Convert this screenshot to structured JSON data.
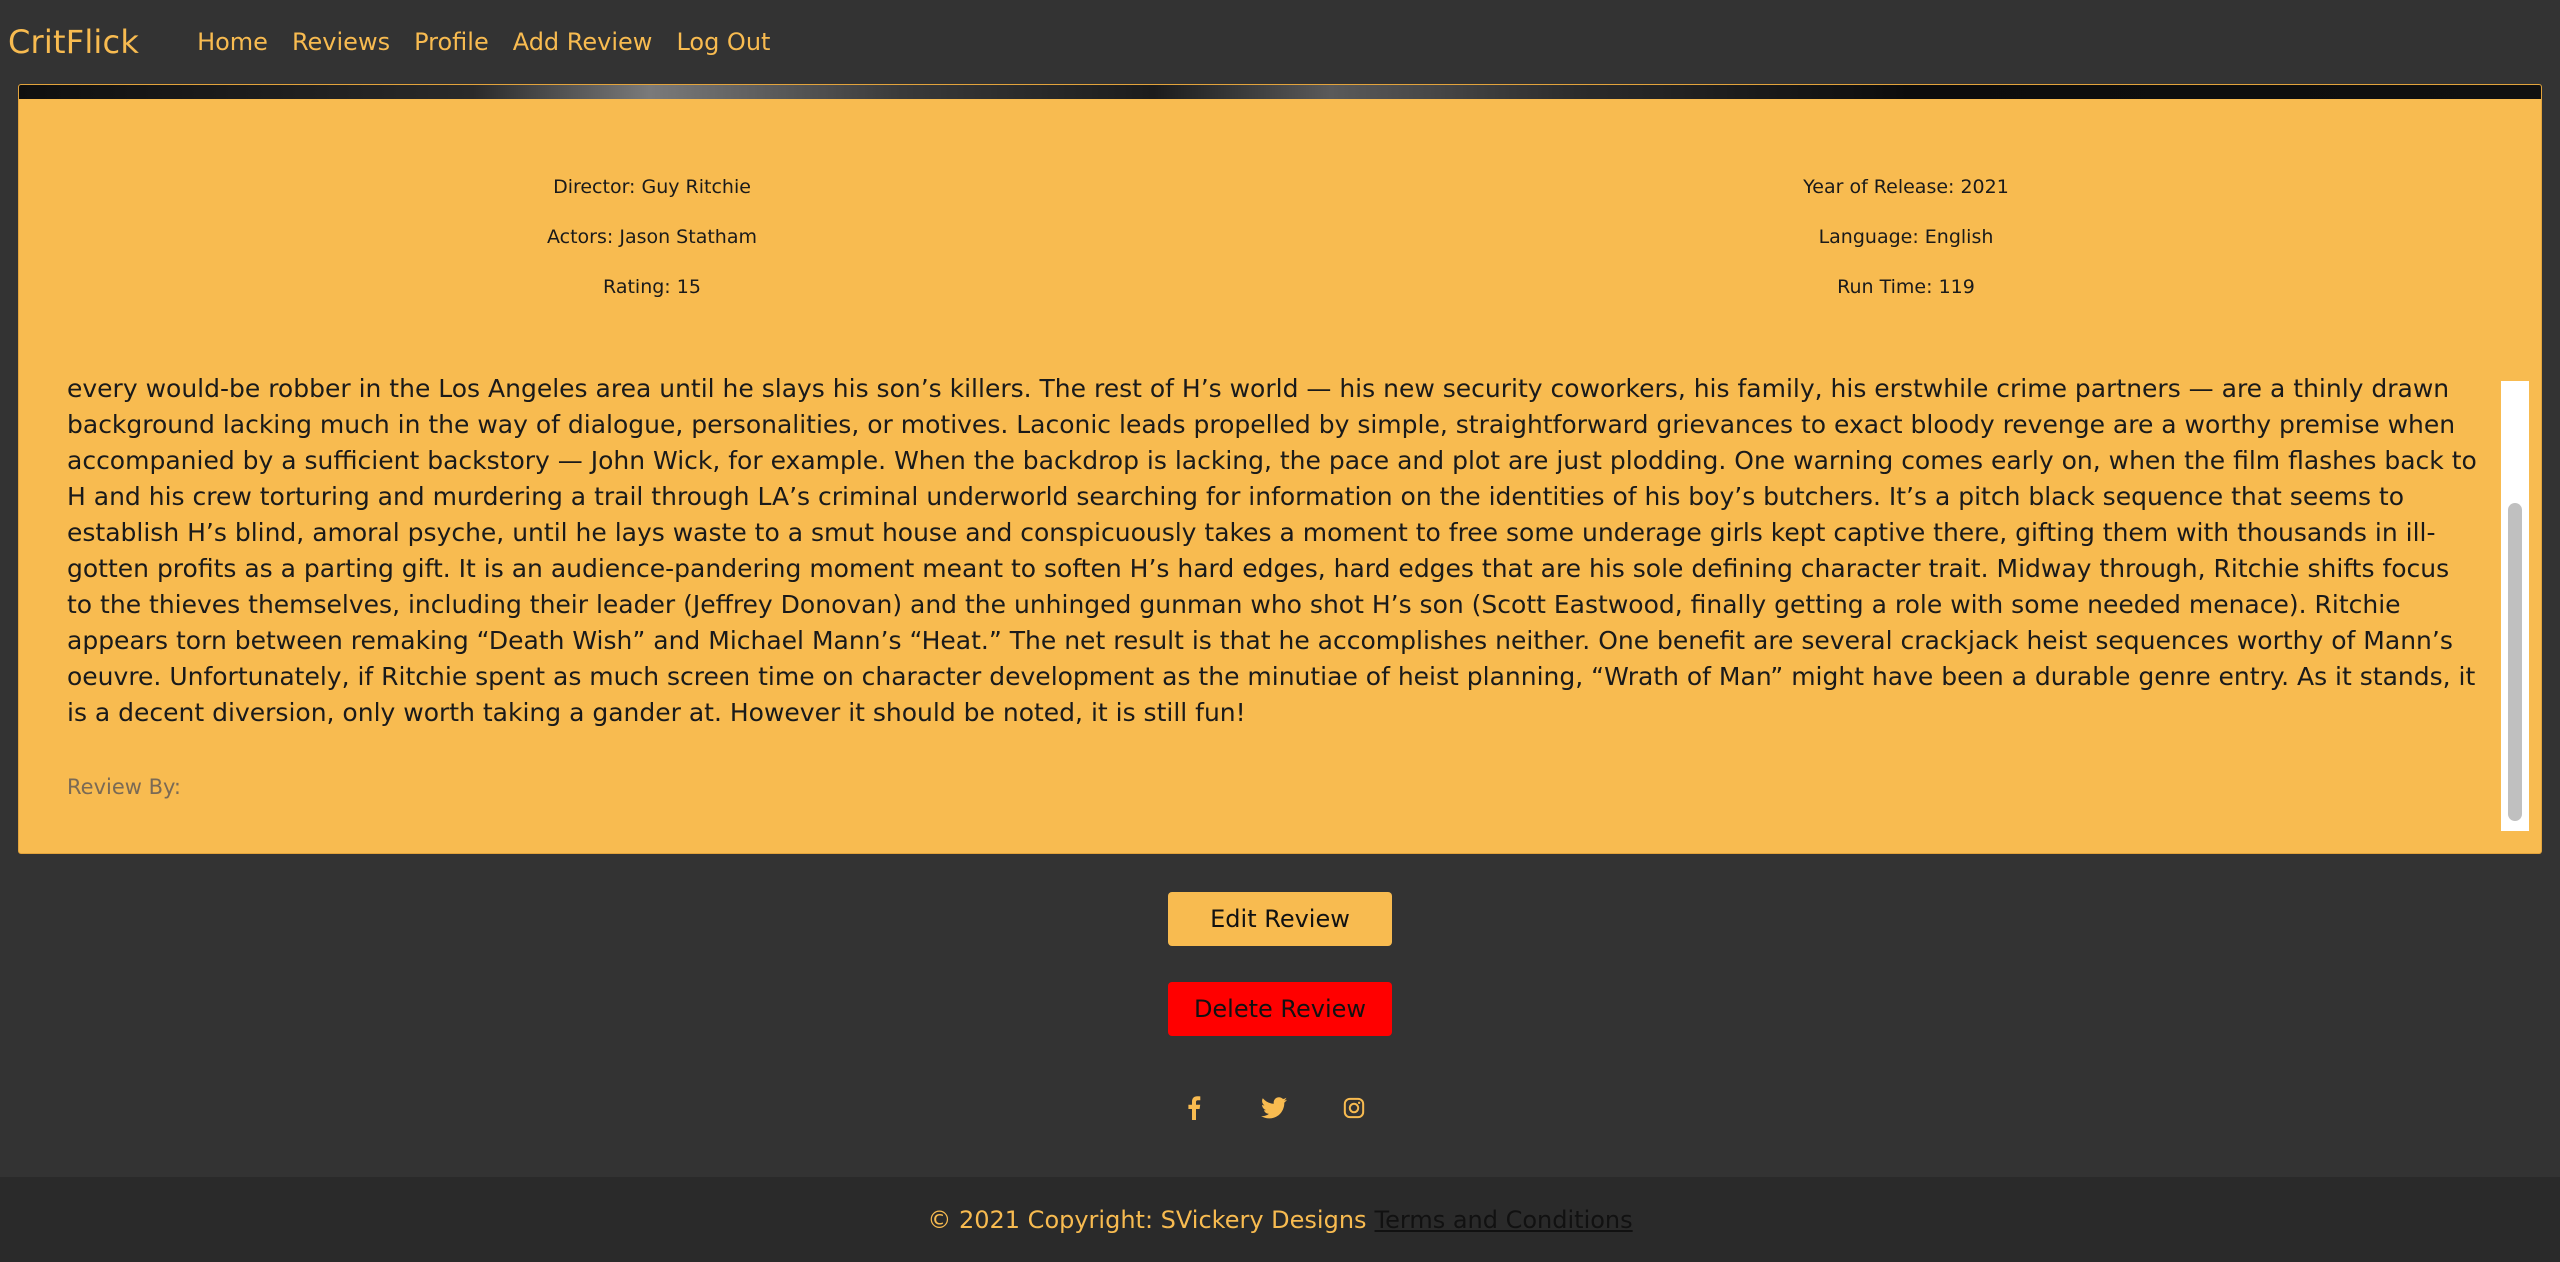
{
  "navbar": {
    "brand": "CritFlick",
    "links": [
      "Home",
      "Reviews",
      "Profile",
      "Add Review",
      "Log Out"
    ]
  },
  "movie": {
    "director": "Director: Guy Ritchie",
    "actors": "Actors: Jason Statham",
    "rating": "Rating: 15",
    "year": "Year of Release: 2021",
    "language": "Language: English",
    "runtime": "Run Time: 119"
  },
  "review": {
    "body": "every would-be robber in the Los Angeles area until he slays his son’s killers. The rest of H’s world — his new security coworkers, his family, his erstwhile crime partners — are a thinly drawn background lacking much in the way of dialogue, personalities, or motives. Laconic leads propelled by simple, straightforward grievances to exact bloody revenge are a worthy premise when accompanied by a sufficient backstory — John Wick, for example. When the backdrop is lacking, the pace and plot are just plodding. One warning comes early on, when the film flashes back to H and his crew torturing and murdering a trail through LA’s criminal underworld searching for information on the identities of his boy’s butchers. It’s a pitch black sequence that seems to establish H’s blind, amoral psyche, until he lays waste to a smut house and conspicuously takes a moment to free some underage girls kept captive there, gifting them with thousands in ill-gotten profits as a parting gift. It is an audience-pandering moment meant to soften H’s hard edges, hard edges that are his sole defining character trait. Midway through, Ritchie shifts focus to the thieves themselves, including their leader (Jeffrey Donovan) and the unhinged gunman who shot H’s son (Scott Eastwood, finally getting a role with some needed menace). Ritchie appears torn between remaking “Death Wish” and Michael Mann’s “Heat.” The net result is that he accomplishes neither. One benefit are several crackjack heist sequences worthy of Mann’s oeuvre. Unfortunately, if Ritchie spent as much screen time on character development as the minutiae of heist planning, “Wrath of Man” might have been a durable genre entry. As it stands, it is a decent diversion, only worth taking a gander at. However it should be noted, it is still fun!",
    "review_by": "Review By:"
  },
  "actions": {
    "edit_label": "Edit Review",
    "delete_label": "Delete Review"
  },
  "social": {
    "icons": [
      "facebook-icon",
      "twitter-icon",
      "instagram-icon"
    ]
  },
  "footer": {
    "copyright": "© 2021 Copyright: SVickery Designs",
    "terms": "Terms and Conditions"
  },
  "colors": {
    "accent": "#f8bb50",
    "background": "#333333",
    "footer_bg": "#2a2a2a",
    "delete": "#ff0000"
  }
}
